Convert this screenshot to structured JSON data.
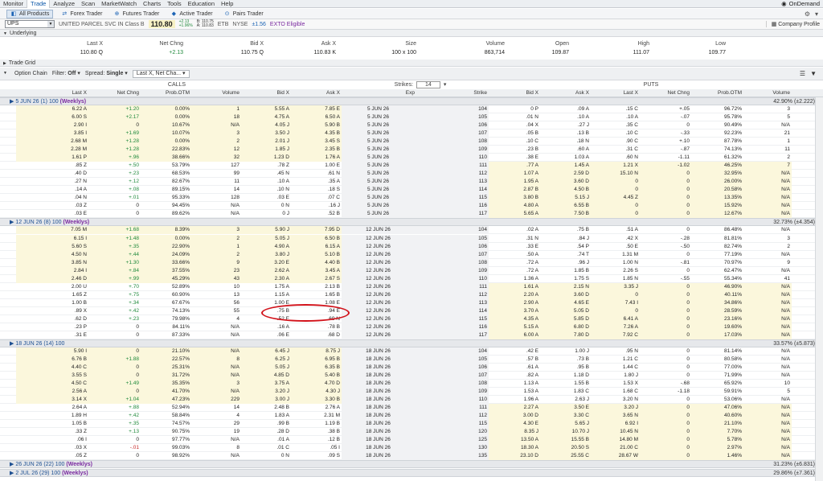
{
  "menu": {
    "items": [
      "Monitor",
      "Trade",
      "Analyze",
      "Scan",
      "MarketWatch",
      "Charts",
      "Tools",
      "Education",
      "Help"
    ],
    "ondemand": "OnDemand"
  },
  "subtabs": [
    "All Products",
    "Forex Trader",
    "Futures Trader",
    "Active Trader",
    "Pairs Trader"
  ],
  "symbol": {
    "ticker": "UPS",
    "name": "UNITED PARCEL SVC IN Class B",
    "last": "110.80",
    "chg_up": "+2.13",
    "chg_pct": "+1.96%",
    "bid_line": "B: 110.75",
    "ask_line": "A: 110.83",
    "etb": "ETB",
    "exch": "NYSE",
    "iv": "±1.56",
    "exto": "EXTO Eligible",
    "company_profile": "Company Profile"
  },
  "underlying": {
    "title": "Underlying",
    "headers": [
      "Last X",
      "Net Chng",
      "Bid X",
      "Ask X",
      "Size",
      "Volume",
      "Open",
      "High",
      "Low"
    ],
    "values": [
      "110.80 Q",
      "+2.13",
      "110.75 Q",
      "110.83 K",
      "100 x 100",
      "863,714",
      "109.87",
      "111.07",
      "109.77"
    ]
  },
  "trade_grid": "Trade Grid",
  "option_chain": {
    "title": "Option Chain",
    "filter": "Filter:",
    "filter_val": "Off",
    "spread": "Spread:",
    "spread_val": "Single",
    "layout": "Last X, Net Cha...",
    "strikes_label": "Strikes:",
    "strikes_val": "14",
    "calls": "CALLS",
    "puts": "PUTS"
  },
  "call_headers": [
    "Last X",
    "Net Chng",
    "Prob.OTM",
    "Volume",
    "Bid X",
    "Ask X"
  ],
  "mid_headers": [
    "Exp",
    "Strike"
  ],
  "put_headers": [
    "Bid X",
    "Ask X",
    "Last X",
    "Net Chng",
    "Prob.OTM",
    "Volume"
  ],
  "expirations": [
    {
      "label": "5 JUN 26",
      "count": "(1)",
      "size": "100",
      "wk": "(Weeklys)",
      "iv": "42.90% (±2.222)",
      "exp": "5 JUN 26",
      "rows": [
        [
          "6.22 A",
          "+1.20",
          "0.00%",
          "1",
          "5.55 A",
          "7.85 E",
          "104",
          "0 P",
          ".09 A",
          ".15 C",
          "+.05",
          "96.72%",
          "3"
        ],
        [
          "6.00 S",
          "+2.17",
          "0.00%",
          "18",
          "4.75 A",
          "6.50 A",
          "105",
          ".01 N",
          ".10 A",
          ".10 A",
          "-.07",
          "95.78%",
          "5"
        ],
        [
          "2.90 I",
          "0",
          "10.67%",
          "N/A",
          "4.05 J",
          "5.90 B",
          "106",
          ".04 X",
          ".27 J",
          ".35 C",
          "0",
          "90.49%",
          "N/A"
        ],
        [
          "3.85 I",
          "+1.69",
          "10.07%",
          "3",
          "3.50 J",
          "4.35 B",
          "107",
          ".05 B",
          ".13 B",
          ".10 C",
          "-.33",
          "92.23%",
          "21"
        ],
        [
          "2.68 M",
          "+1.28",
          "0.00%",
          "2",
          "2.01 J",
          "3.45 S",
          "108",
          ".10 C",
          ".18 N",
          ".90 C",
          "+.10",
          "87.78%",
          "1"
        ],
        [
          "2.28 M",
          "+1.28",
          "22.83%",
          "12",
          "1.85 J",
          "2.35 B",
          "109",
          ".23 B",
          ".60 A",
          ".31 C",
          "-.87",
          "74.13%",
          "11"
        ],
        [
          "1.61 P",
          "+.96",
          "38.66%",
          "32",
          "1.23 D",
          "1.76 A",
          "110",
          ".38 E",
          "1.03 A",
          ".60 N",
          "-1.11",
          "61.32%",
          "2"
        ],
        [
          ".85 Z",
          "+.50",
          "53.79%",
          "127",
          ".78 Z",
          "1.00 E",
          "111",
          ".77 A",
          "1.45 A",
          "1.21 X",
          "-1.02",
          "46.25%",
          "7"
        ],
        [
          ".40 D",
          "+.23",
          "68.53%",
          "99",
          ".45 N",
          ".61 N",
          "112",
          "1.07 A",
          "2.59 D",
          "15.10 N",
          "0",
          "32.95%",
          "N/A"
        ],
        [
          ".27 N",
          "+.12",
          "82.67%",
          "11",
          ".10 A",
          ".35 A",
          "113",
          "1.95 A",
          "3.60 D",
          "0",
          "0",
          "26.00%",
          "N/A"
        ],
        [
          ".14 A",
          "+.08",
          "89.15%",
          "14",
          ".10 N",
          ".18 S",
          "114",
          "2.87 B",
          "4.50 B",
          "0",
          "0",
          "20.58%",
          "N/A"
        ],
        [
          ".04 N",
          "+.01",
          "95.33%",
          "128",
          ".03 E",
          ".07 C",
          "115",
          "3.80 B",
          "5.15 J",
          "4.45 Z",
          "0",
          "13.35%",
          "N/A"
        ],
        [
          ".03 Z",
          "0",
          "94.45%",
          "N/A",
          "0 N",
          ".16 J",
          "116",
          "4.80 A",
          "6.55 B",
          "0",
          "0",
          "15.92%",
          "N/A"
        ],
        [
          ".03 E",
          "0",
          "89.62%",
          "N/A",
          "0 J",
          ".52 B",
          "117",
          "5.65 A",
          "7.50 B",
          "0",
          "0",
          "12.67%",
          "N/A"
        ]
      ]
    },
    {
      "label": "12 JUN 26",
      "count": "(8)",
      "size": "100",
      "wk": "(Weeklys)",
      "iv": "32.73% (±4.354)",
      "exp": "12 JUN 26",
      "rows": [
        [
          "7.05 M",
          "+1.68",
          "8.39%",
          "3",
          "5.90 J",
          "7.95 D",
          "104",
          ".02 A",
          ".75 B",
          ".51 A",
          "0",
          "86.48%",
          "N/A"
        ],
        [
          "6.15 I",
          "+1.48",
          "0.00%",
          "2",
          "5.05 J",
          "6.50 B",
          "105",
          ".31 N",
          ".84 J",
          ".42 X",
          "-.28",
          "81.81%",
          "3"
        ],
        [
          "5.60 S",
          "+.35",
          "22.90%",
          "1",
          "4.90 A",
          "6.15 A",
          "106",
          ".33 E",
          ".54 P",
          ".50 E",
          "-.50",
          "82.74%",
          "2"
        ],
        [
          "4.50 N",
          "+.44",
          "24.09%",
          "2",
          "3.80 J",
          "5.10 B",
          "107",
          ".50 A",
          ".74 T",
          "1.31 M",
          "0",
          "77.19%",
          "N/A"
        ],
        [
          "3.85 N",
          "+1.30",
          "33.66%",
          "9",
          "3.20 E",
          "4.40 B",
          "108",
          ".72 A",
          ".96 J",
          "1.00 N",
          "-.81",
          "70.97%",
          "9"
        ],
        [
          "2.84 I",
          "+.84",
          "37.55%",
          "23",
          "2.62 A",
          "3.45 A",
          "109",
          ".72 A",
          "1.85 B",
          "2.26 S",
          "0",
          "62.47%",
          "N/A"
        ],
        [
          "2.46 D",
          "+.99",
          "45.29%",
          "43",
          "2.30 A",
          "2.67 S",
          "110",
          "1.36 A",
          "1.75 S",
          "1.85 N",
          "-.55",
          "55.34%",
          "41"
        ],
        [
          "2.00 U",
          "+.70",
          "52.89%",
          "10",
          "1.75 A",
          "2.13 B",
          "111",
          "1.61 A",
          "2.15 N",
          "3.35 J",
          "0",
          "46.90%",
          "N/A"
        ],
        [
          "1.65 Z",
          "+.75",
          "60.90%",
          "13",
          "1.15 A",
          "1.65 B",
          "112",
          "2.20 A",
          "3.60 D",
          "0",
          "0",
          "40.11%",
          "N/A"
        ],
        [
          "1.00 B",
          "+.34",
          "67.67%",
          "56",
          "1.00 E",
          "1.08 E",
          "113",
          "2.90 A",
          "4.65 E",
          "7.43 I",
          "0",
          "34.86%",
          "N/A"
        ],
        [
          ".89 X",
          "+.42",
          "74.13%",
          "55",
          ".75 B",
          ".94 E",
          "114",
          "3.70 A",
          "5.05 D",
          "0",
          "0",
          "28.59%",
          "N/A"
        ],
        [
          ".62 D",
          "+.23",
          "79.98%",
          "4",
          ".52 E",
          ".69 N",
          "115",
          "4.35 A",
          "5.85 D",
          "6.41 A",
          "0",
          "23.16%",
          "N/A"
        ],
        [
          ".23 P",
          "0",
          "84.11%",
          "N/A",
          ".16 A",
          ".78 B",
          "116",
          "5.15 A",
          "6.80 D",
          "7.26 A",
          "0",
          "19.60%",
          "N/A"
        ],
        [
          ".31 E",
          "0",
          "87.33%",
          "N/A",
          ".06 E",
          ".68 D",
          "117",
          "6.00 A",
          "7.80 D",
          "7.92 C",
          "0",
          "17.03%",
          "N/A"
        ]
      ]
    },
    {
      "label": "18 JUN 26",
      "count": "(14)",
      "size": "100",
      "wk": "",
      "iv": "33.57% (±5.873)",
      "exp": "18 JUN 26",
      "rows": [
        [
          "5.90 I",
          "0",
          "21.10%",
          "N/A",
          "6.45 J",
          "8.75 J",
          "104",
          ".42 E",
          "1.00 J",
          ".95 N",
          "0",
          "81.14%",
          "N/A"
        ],
        [
          "6.76 B",
          "+1.88",
          "22.57%",
          "8",
          "6.25 J",
          "6.95 B",
          "105",
          ".57 B",
          ".73 B",
          "1.21 C",
          "0",
          "80.58%",
          "N/A"
        ],
        [
          "4.40 C",
          "0",
          "25.31%",
          "N/A",
          "5.05 J",
          "6.35 B",
          "106",
          ".61 A",
          ".95 B",
          "1.44 C",
          "0",
          "77.00%",
          "N/A"
        ],
        [
          "3.55 S",
          "0",
          "31.72%",
          "N/A",
          "4.85 D",
          "5.40 B",
          "107",
          ".82 A",
          "1.18 D",
          "1.80 J",
          "0",
          "71.99%",
          "N/A"
        ],
        [
          "4.50 C",
          "+1.49",
          "35.35%",
          "3",
          "3.75 A",
          "4.70 D",
          "108",
          "1.13 A",
          "1.55 B",
          "1.53 X",
          "-.68",
          "65.92%",
          "10"
        ],
        [
          "2.56 A",
          "0",
          "41.70%",
          "N/A",
          "3.20 J",
          "4.30 J",
          "109",
          "1.53 A",
          "1.83 C",
          "1.68 C",
          "-1.18",
          "59.91%",
          "5"
        ],
        [
          "3.14 X",
          "+1.04",
          "47.23%",
          "229",
          "3.00 J",
          "3.30 B",
          "110",
          "1.96 A",
          "2.63 J",
          "3.20 N",
          "0",
          "53.06%",
          "N/A"
        ],
        [
          "2.64 A",
          "+.88",
          "52.94%",
          "14",
          "2.48 B",
          "2.76 A",
          "111",
          "2.27 A",
          "3.50 E",
          "3.20 J",
          "0",
          "47.06%",
          "N/A"
        ],
        [
          "1.89 H",
          "+.42",
          "58.84%",
          "4",
          "1.83 A",
          "2.31 M",
          "112",
          "3.00 D",
          "3.30 C",
          "3.65 N",
          "0",
          "40.60%",
          "N/A"
        ],
        [
          "1.05 B",
          "+.35",
          "74.57%",
          "29",
          ".99 B",
          "1.19 B",
          "115",
          "4.30 E",
          "5.65 J",
          "6.92 I",
          "0",
          "21.10%",
          "N/A"
        ],
        [
          ".33 Z",
          "+.13",
          "90.75%",
          "19",
          ".28 D",
          ".38 B",
          "120",
          "8.35 J",
          "10.70 J",
          "10.45 N",
          "0",
          "7.70%",
          "N/A"
        ],
        [
          ".06 I",
          "0",
          "97.77%",
          "N/A",
          ".01 A",
          ".12 B",
          "125",
          "13.50 A",
          "15.55 B",
          "14.80 M",
          "0",
          "5.78%",
          "N/A"
        ],
        [
          ".03 X",
          "-.01",
          "99.03%",
          "8",
          ".01 C",
          ".05 I",
          "130",
          "18.30 A",
          "20.50 S",
          "21.00 C",
          "0",
          "2.97%",
          "N/A"
        ],
        [
          ".05 Z",
          "0",
          "98.92%",
          "N/A",
          "0 N",
          ".09 S",
          "135",
          "23.10 D",
          "25.55 C",
          "28.67 W",
          "0",
          "1.46%",
          "N/A"
        ]
      ]
    }
  ],
  "tail": [
    {
      "label": "26 JUN 26",
      "count": "(22)",
      "size": "100",
      "wk": "(Weeklys)",
      "iv": "31.23% (±6.831)"
    },
    {
      "label": "2 JUL 26",
      "count": "(29)",
      "size": "100",
      "wk": "(Weeklys)",
      "iv": "29.86% (±7.361)"
    }
  ],
  "itm_strikes_max": 110
}
